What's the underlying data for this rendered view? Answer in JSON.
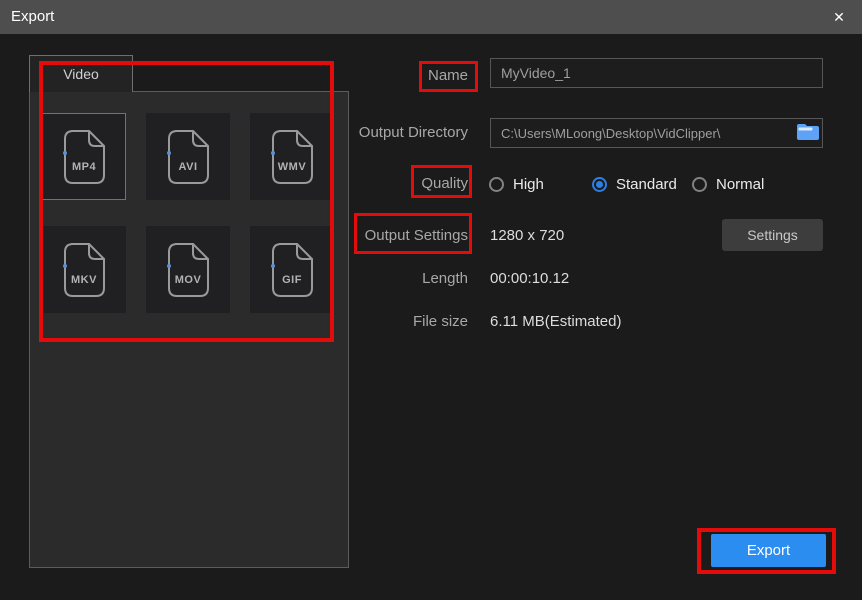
{
  "window": {
    "title": "Export"
  },
  "icons": {
    "close": "✕",
    "folder": "folder-icon",
    "file_page": "file-page-icon"
  },
  "format_panel": {
    "tab_label": "Video",
    "formats": [
      {
        "label": "MP4",
        "selected": true
      },
      {
        "label": "AVI",
        "selected": false
      },
      {
        "label": "WMV",
        "selected": false
      },
      {
        "label": "MKV",
        "selected": false
      },
      {
        "label": "MOV",
        "selected": false
      },
      {
        "label": "GIF",
        "selected": false
      }
    ]
  },
  "fields": {
    "name": {
      "label": "Name",
      "value": "MyVideo_1"
    },
    "output_directory": {
      "label": "Output Directory",
      "value": "C:\\Users\\MLoong\\Desktop\\VidClipper\\"
    },
    "quality": {
      "label": "Quality",
      "options": [
        {
          "label": "High",
          "selected": false
        },
        {
          "label": "Standard",
          "selected": true
        },
        {
          "label": "Normal",
          "selected": false
        }
      ]
    },
    "output_settings": {
      "label": "Output Settings",
      "value": "1280 x 720",
      "button_label": "Settings"
    },
    "length": {
      "label": "Length",
      "value": "00:00:10.12"
    },
    "file_size": {
      "label": "File size",
      "value": "6.11 MB(Estimated)"
    }
  },
  "export_button": {
    "label": "Export"
  },
  "colors": {
    "accent_blue": "#2b8df0",
    "annotation_red": "#e40b0b",
    "selected_tile_border": "#2e7fe4",
    "radio_blue": "#2b7fe8",
    "folder_icon_blue": "#5ea2f7"
  }
}
